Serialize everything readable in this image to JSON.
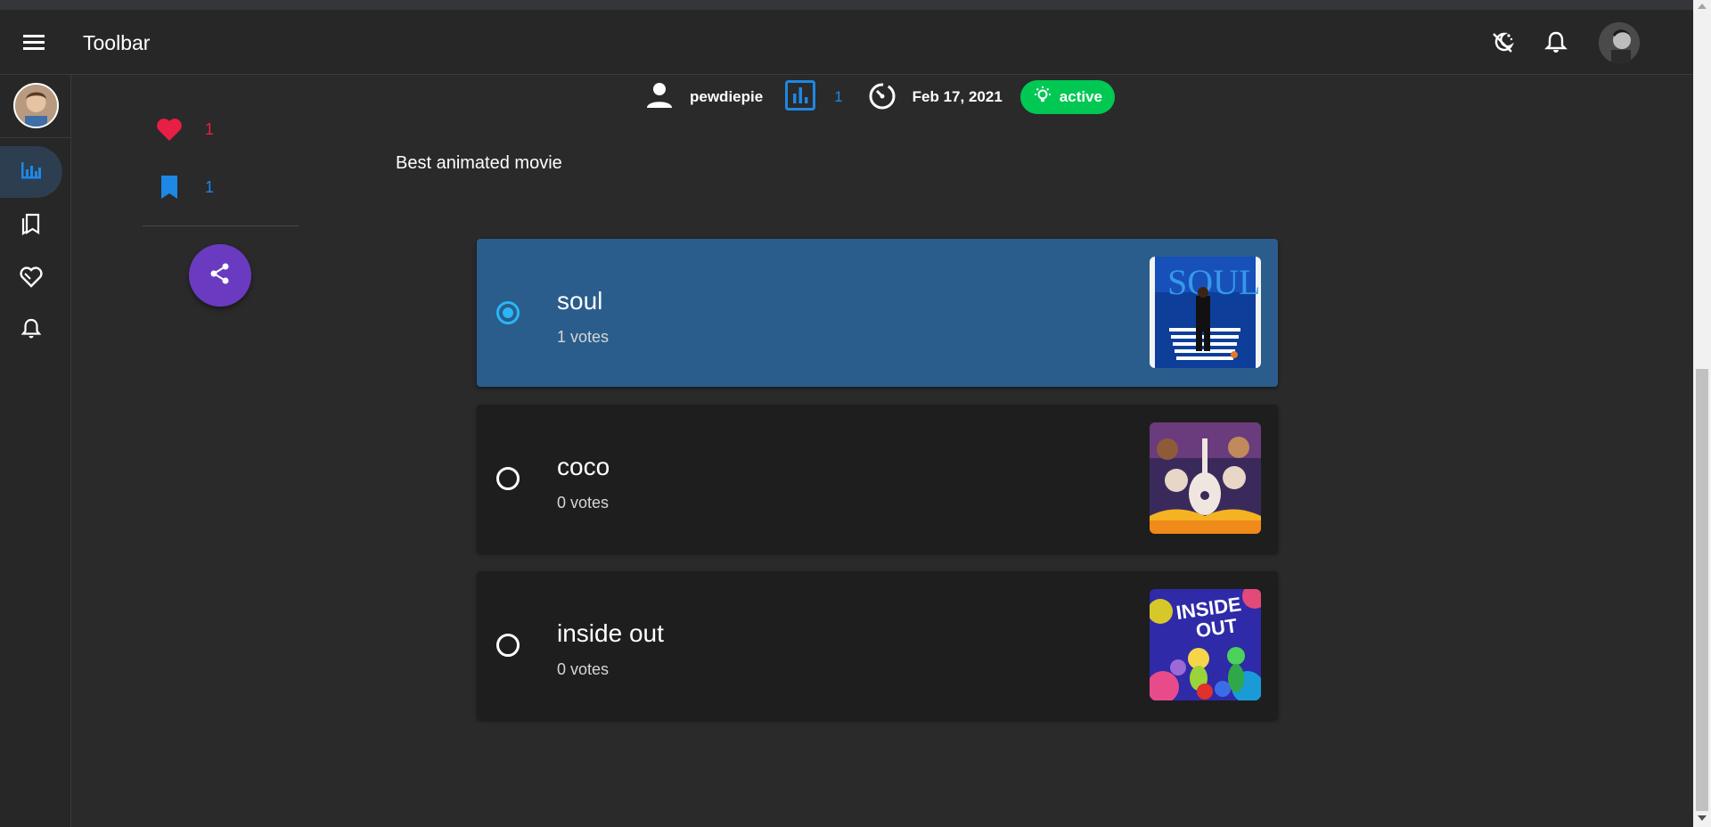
{
  "toolbar": {
    "title": "Toolbar",
    "menu_icon": "menu-icon",
    "theme_icon": "theme-toggle-icon",
    "notifications_icon": "bell-icon"
  },
  "rail": {
    "items": [
      {
        "name": "polls",
        "icon": "bar-chart-icon",
        "active": true
      },
      {
        "name": "bookmarks",
        "icon": "bookmarks-icon",
        "active": false
      },
      {
        "name": "likes",
        "icon": "heart-outline-icon",
        "active": false
      },
      {
        "name": "notifications",
        "icon": "bell-icon",
        "active": false
      }
    ]
  },
  "actions": {
    "likes_count": "1",
    "bookmarks_count": "1",
    "share_icon": "share-icon"
  },
  "meta": {
    "author": "pewdiepie",
    "votes_total": "1",
    "date": "Feb 17, 2021",
    "status": "active"
  },
  "poll": {
    "question": "Best animated movie",
    "options": [
      {
        "name": "soul",
        "votes": "1 votes",
        "selected": true
      },
      {
        "name": "coco",
        "votes": "0 votes",
        "selected": false
      },
      {
        "name": "inside out",
        "votes": "0 votes",
        "selected": false
      }
    ]
  },
  "colors": {
    "accent_blue": "#1e88e5",
    "selected_option": "#2a5d8c",
    "heart_red": "#e91e44",
    "status_green": "#00c853",
    "share_purple": "#6a3bc0"
  }
}
